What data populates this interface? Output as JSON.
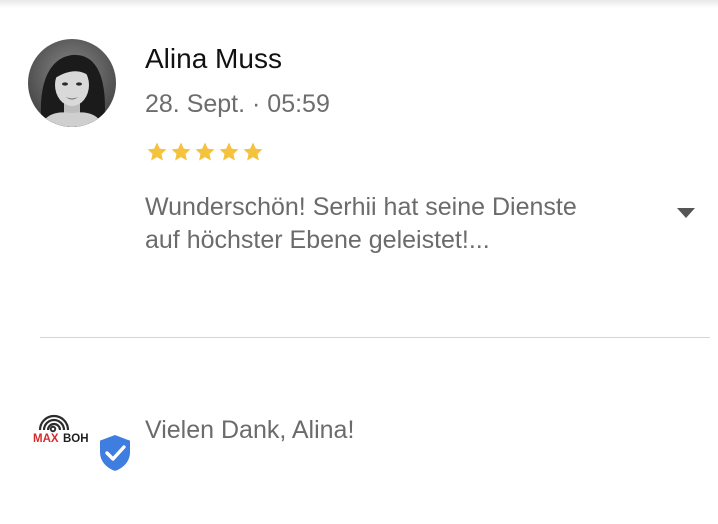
{
  "review": {
    "author_name": "Alina Muss",
    "date": "28. Sept. · 05:59",
    "rating": 5,
    "rating_max": 5,
    "star_color": "#f4c23c",
    "text": "Wunderschön! Serhii hat seine Dienste auf höchster Ebene geleistet!..."
  },
  "owner_reply": {
    "logo_text": "MAX BOH",
    "text": "Vielen Dank, Alina!",
    "verified_color": "#3f7de0"
  }
}
